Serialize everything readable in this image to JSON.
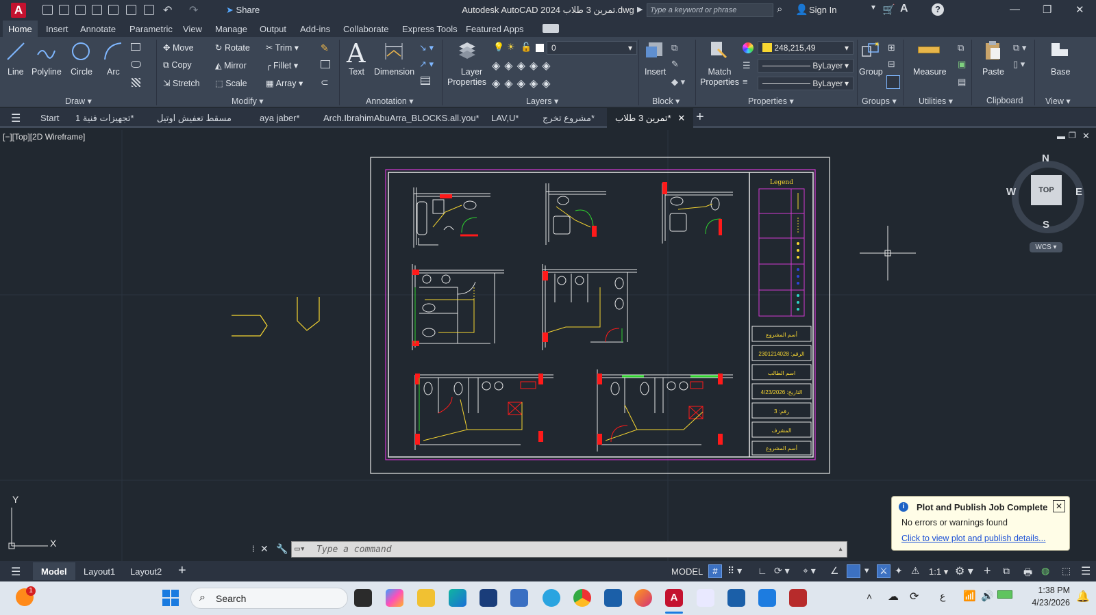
{
  "window": {
    "title": "Autodesk AutoCAD 2024  تمرين 3 طلاب.dwg",
    "share_label": "Share",
    "search_placeholder": "Type a keyword or phrase",
    "sign_in": "Sign In"
  },
  "ribbon_tabs": [
    "Home",
    "Insert",
    "Annotate",
    "Parametric",
    "View",
    "Manage",
    "Output",
    "Add-ins",
    "Collaborate",
    "Express Tools",
    "Featured Apps"
  ],
  "ribbon": {
    "draw": {
      "line": "Line",
      "polyline": "Polyline",
      "circle": "Circle",
      "arc": "Arc",
      "panel": "Draw"
    },
    "modify": {
      "move": "Move",
      "rotate": "Rotate",
      "trim": "Trim",
      "copy": "Copy",
      "mirror": "Mirror",
      "fillet": "Fillet",
      "stretch": "Stretch",
      "scale": "Scale",
      "array": "Array",
      "panel": "Modify"
    },
    "annotation": {
      "text": "Text",
      "dimension": "Dimension",
      "panel": "Annotation"
    },
    "layers": {
      "layer_properties_1": "Layer",
      "layer_properties_2": "Properties",
      "current_layer": "0",
      "panel": "Layers"
    },
    "block": {
      "insert": "Insert",
      "panel": "Block"
    },
    "properties": {
      "match_1": "Match",
      "match_2": "Properties",
      "color_value": "248,215,49",
      "linetype": "ByLayer",
      "lineweight": "ByLayer",
      "panel": "Properties"
    },
    "groups": {
      "group": "Group",
      "panel": "Groups"
    },
    "utilities": {
      "measure": "Measure",
      "panel": "Utilities"
    },
    "clipboard": {
      "paste": "Paste",
      "panel": "Clipboard"
    },
    "view": {
      "base": "Base",
      "panel": "View"
    }
  },
  "doc_tabs": [
    "Start",
    "تجهيزات فنية 1*",
    "مسقط تعفيش اوتيل",
    "aya jaber*",
    "Arch.IbrahimAbuArra_BLOCKS.all.you*",
    "LAV,U*",
    "مشروع تخرج*",
    "تمرين 3 طلاب*"
  ],
  "viewport_label": "[−][Top][2D Wireframe]",
  "viewcube": {
    "n": "N",
    "s": "S",
    "e": "E",
    "w": "W",
    "top": "TOP",
    "wcs": "WCS"
  },
  "drawing": {
    "legend_title": "Legend",
    "title_rows": [
      "أسم المشروع",
      "2301214028 :الرقم",
      "اسم الطالب",
      "4/23/2026 :التاريخ",
      "3 :رقم",
      "المشرف",
      "أسم المشروع"
    ]
  },
  "ucs": {
    "x": "X",
    "y": "Y"
  },
  "command_placeholder": "Type a command",
  "notification": {
    "title": "Plot and Publish Job Complete",
    "message": "No errors or warnings found",
    "link": "Click to view plot and publish details..."
  },
  "status_tabs": [
    "Model",
    "Layout1",
    "Layout2"
  ],
  "status": {
    "model": "MODEL",
    "scale": "1:1"
  },
  "taskbar": {
    "search": "Search",
    "time": "1:38 PM",
    "date": "4/23/2026",
    "lang": "ع",
    "badge": "1"
  },
  "colors": {
    "accent": "#c4122f",
    "bg": "#212830",
    "ribbon": "#3b4554",
    "selected_color": "#f8d731"
  }
}
